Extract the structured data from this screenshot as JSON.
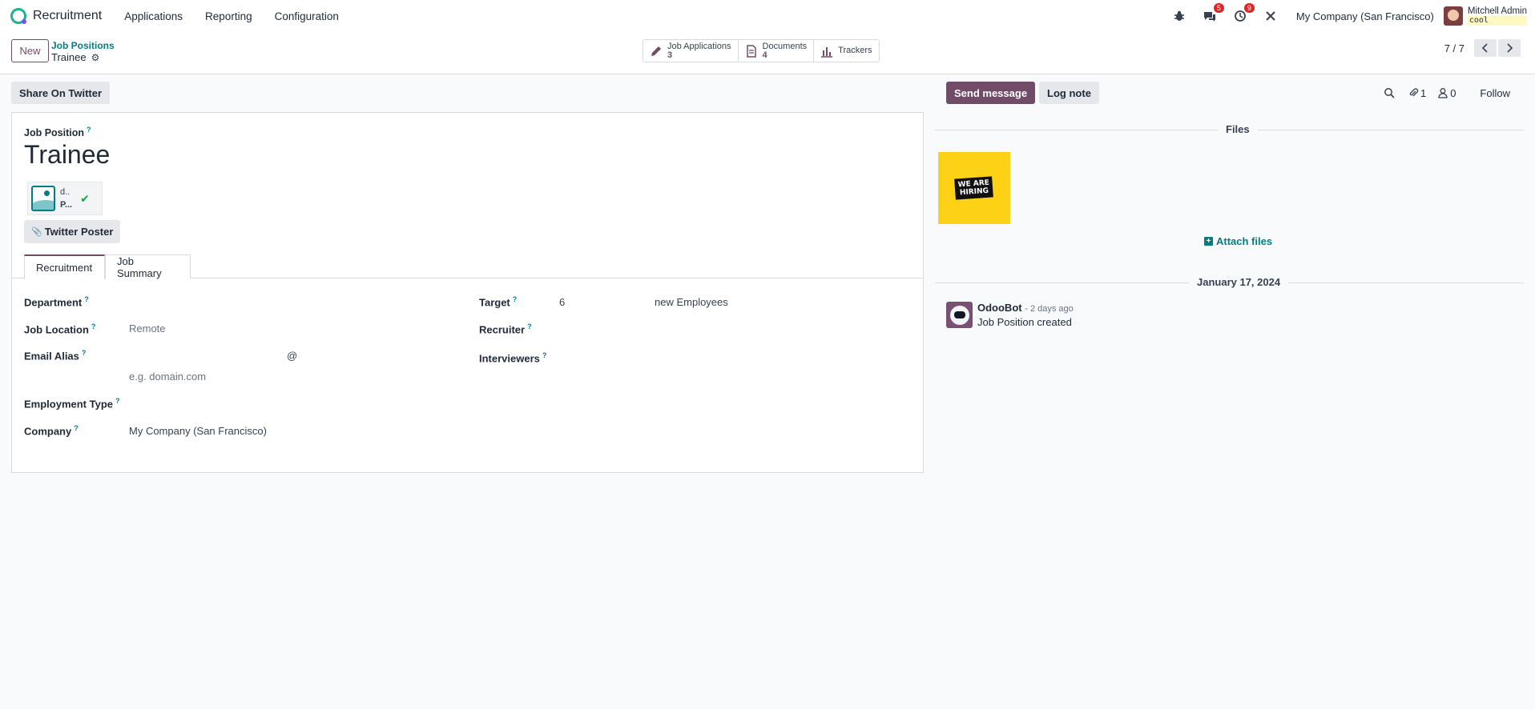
{
  "navbar": {
    "app_name": "Recruitment",
    "menus": [
      "Applications",
      "Reporting",
      "Configuration"
    ],
    "bug_icon": "bug-icon",
    "messages_badge": "5",
    "activities_badge": "9",
    "company": "My Company (San Francisco)",
    "user_name": "Mitchell Admin",
    "user_db": "cool"
  },
  "control_panel": {
    "new_label": "New",
    "breadcrumb_parent": "Job Positions",
    "breadcrumb_current": "Trainee",
    "smart_buttons": [
      {
        "label": "Job Applications",
        "value": "3",
        "icon": "pencil-icon"
      },
      {
        "label": "Documents",
        "value": "4",
        "icon": "document-icon"
      },
      {
        "label": "Trackers",
        "value": "",
        "icon": "bar-chart-icon"
      }
    ],
    "pager": "7 / 7"
  },
  "form": {
    "share_twitter_label": "Share On Twitter",
    "job_position_label": "Job Position",
    "help_mark": "?",
    "job_title": "Trainee",
    "attachment": {
      "name1": "d..",
      "name2": "P..."
    },
    "twitter_poster_label": "Twitter Poster",
    "tabs": [
      {
        "label": "Recruitment"
      },
      {
        "label": "Job Summary"
      }
    ],
    "fields": {
      "department_label": "Department",
      "job_location_label": "Job Location",
      "job_location_value": "Remote",
      "email_alias_label": "Email Alias",
      "at_sign": "@",
      "domain_placeholder": "e.g. domain.com",
      "employment_type_label": "Employment Type",
      "company_label": "Company",
      "company_value": "My Company (San Francisco)",
      "target_label": "Target",
      "target_value": "6",
      "target_unit": "new Employees",
      "recruiter_label": "Recruiter",
      "interviewers_label": "Interviewers"
    }
  },
  "chatter": {
    "send_message_label": "Send message",
    "log_note_label": "Log note",
    "attachments_count": "1",
    "followers_count": "0",
    "follow_label": "Follow",
    "files_title": "Files",
    "hiring_line1": "WE ARE",
    "hiring_line2": "HIRING",
    "attach_files_label": "Attach files",
    "date_separator": "January 17, 2024",
    "message": {
      "author": "OdooBot",
      "date": "- 2 days ago",
      "text": "Job Position created"
    }
  }
}
